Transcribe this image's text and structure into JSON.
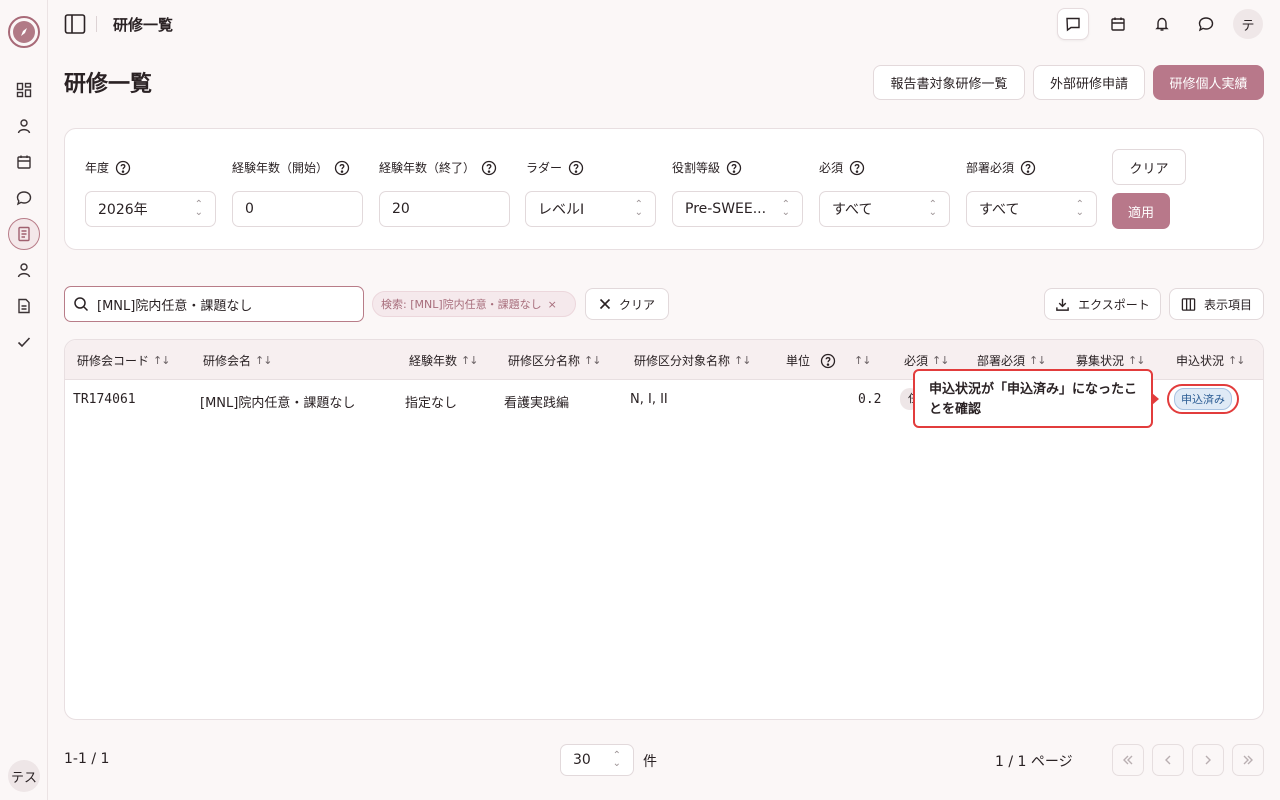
{
  "topbar": {
    "title": "研修一覧",
    "avatar": "テ"
  },
  "sidebar": {
    "avatar": "テス"
  },
  "header": {
    "title": "研修一覧",
    "btn_report": "報告書対象研修一覧",
    "btn_external": "外部研修申請",
    "btn_personal": "研修個人実績"
  },
  "filters": {
    "year": {
      "label": "年度",
      "value": "2026年"
    },
    "exp_start": {
      "label": "経験年数（開始）",
      "value": "0"
    },
    "exp_end": {
      "label": "経験年数（終了）",
      "value": "20"
    },
    "ladder": {
      "label": "ラダー",
      "value": "レベルⅠ"
    },
    "grade": {
      "label": "役割等級",
      "value": "Pre-SWEE..."
    },
    "required": {
      "label": "必須",
      "value": "すべて"
    },
    "dept_required": {
      "label": "部署必須",
      "value": "すべて"
    },
    "clear": "クリア",
    "apply": "適用"
  },
  "search": {
    "value": "[MNL]院内任意・課題なし",
    "chip": "検索: [MNL]院内任意・課題なし",
    "clear": "クリア"
  },
  "toolbar": {
    "export": "エクスポート",
    "columns": "表示項目"
  },
  "table": {
    "headers": [
      "研修会コード",
      "研修会名",
      "経験年数",
      "研修区分名称",
      "研修区分対象名称",
      "単位",
      "必須",
      "部署必須",
      "募集状況",
      "申込状況"
    ],
    "rows": [
      {
        "code": "TR174061",
        "name": "[MNL]院内任意・課題なし",
        "experience": "指定なし",
        "category": "看護実践編",
        "target": "N, I, II",
        "unit": "0.2",
        "required": "任",
        "status": "申込済み"
      }
    ]
  },
  "callout": {
    "text": "申込状況が「申込済み」になったことを確認"
  },
  "footer": {
    "count": "1-1 / 1",
    "page_size": "30",
    "unit": "件",
    "page_info": "1 / 1 ページ"
  },
  "colors": {
    "primary": "#b8788a",
    "highlight": "#e23c3c"
  }
}
